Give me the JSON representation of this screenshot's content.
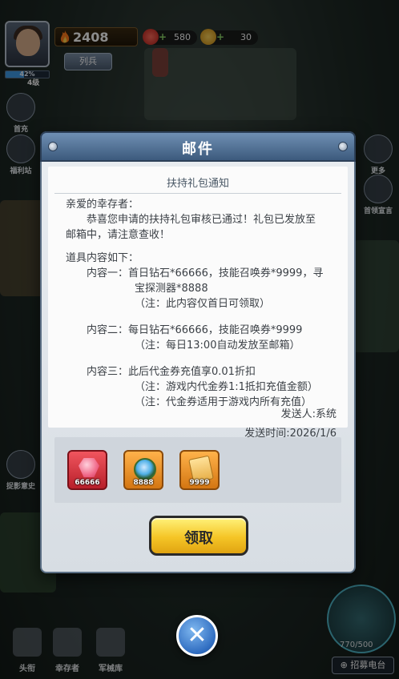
{
  "hud": {
    "level": "4级",
    "exp_percent": "42%",
    "exp_fraction": 0.42,
    "power": "2408",
    "rank_label": "列兵",
    "resources": [
      {
        "icon": "red-gem-icon",
        "value": "580"
      },
      {
        "icon": "gold-coin-icon",
        "value": "30"
      }
    ]
  },
  "side_left": [
    {
      "icon": "scout-icon",
      "label": "首充"
    },
    {
      "icon": "welfare-icon",
      "label": "福利站"
    },
    {
      "icon": "survivor-avatar-icon",
      "label": "捉影意史"
    }
  ],
  "side_right": [
    {
      "icon": "grid-more-icon",
      "label": "更多"
    },
    {
      "icon": "mailbox-icon",
      "label": "首领宣言"
    }
  ],
  "modal": {
    "title": "邮件",
    "letter_title": "扶持礼包通知",
    "greeting": "亲爱的幸存者：",
    "intro_line1": "恭喜您申请的扶持礼包审核已通过！礼包已发放至",
    "intro_line2": "邮箱中，请注意查收！",
    "items_heading": "道具内容如下：",
    "content1_line1": "内容一：首日钻石*66666，技能召唤券*9999，寻",
    "content1_line2": "宝探测器*8888",
    "content1_note": "（注：此内容仅首日可领取）",
    "content2_line1": "内容二：每日钻石*66666，技能召唤券*9999",
    "content2_note": "（注：每日13:00自动发放至邮箱）",
    "content3_line1": "内容三：此后代金券充值享0.01折扣",
    "content3_note1": "（注：游戏内代金券1:1抵扣充值金额）",
    "content3_note2": "（注：代金券适用于游戏内所有充值）",
    "sender": "发送人:系统",
    "send_time": "发送时间:2026/1/6",
    "rewards": [
      {
        "icon": "pink-diamond-icon",
        "count": "66666",
        "color": "#d8343f"
      },
      {
        "icon": "treasure-detector-icon",
        "count": "8888",
        "color": "#e08a1e"
      },
      {
        "icon": "skill-summon-ticket-icon",
        "count": "9999",
        "color": "#e08a1e"
      }
    ],
    "claim_label": "领取"
  },
  "bottom_nav": [
    {
      "icon": "rank-badge-icon",
      "label": "头衔"
    },
    {
      "icon": "survivor-hat-icon",
      "label": "幸存者"
    },
    {
      "icon": "arsenal-icon",
      "label": "军械库"
    }
  ],
  "energy": "770/500",
  "recruit_label": "⊕ 招募电台",
  "colors": {
    "header_blue": "#4d6e94",
    "claim_yellow": "#f5c526",
    "close_blue": "#2f6cc0",
    "reward_panel": "#cfd5dc"
  }
}
